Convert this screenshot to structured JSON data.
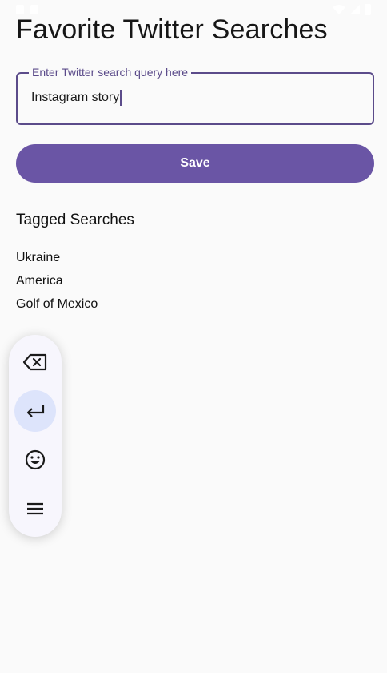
{
  "header": {
    "title": "Favorite Twitter Searches"
  },
  "search": {
    "label": "Enter Twitter search query here",
    "value": "Instagram story"
  },
  "save_label": "Save",
  "tagged": {
    "title": "Tagged Searches",
    "items": [
      "Ukraine",
      "America",
      "Golf of Mexico"
    ]
  },
  "toolbar": {
    "buttons": [
      "backspace-icon",
      "enter-icon",
      "emoji-icon",
      "menu-icon"
    ]
  },
  "colors": {
    "accent": "#6a55a5",
    "outline": "#5b4b8a",
    "active_button": "#dde4fb"
  }
}
